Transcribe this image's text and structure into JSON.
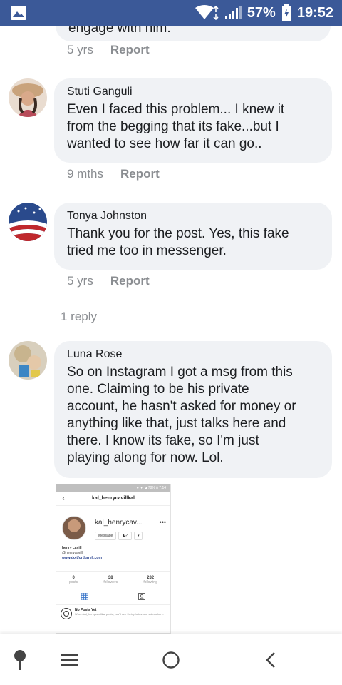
{
  "status_bar": {
    "battery": "57%",
    "time": "19:52"
  },
  "comments": [
    {
      "id": "partial",
      "text": "engage with him.",
      "time": "5 yrs",
      "report_label": "Report"
    },
    {
      "id": "stuti",
      "author": "Stuti Ganguli",
      "lines": [
        "Even I faced this problem... I knew it",
        "from the begging that its fake...but I",
        "wanted to see how far it can go.."
      ],
      "time": "9 mths",
      "report_label": "Report"
    },
    {
      "id": "tonya",
      "author": "Tonya Johnston",
      "lines": [
        "Thank you for the post. Yes, this fake",
        "tried me too in messenger."
      ],
      "time": "5 yrs",
      "report_label": "Report",
      "replies_label": "1 reply"
    },
    {
      "id": "luna",
      "author": "Luna Rose",
      "lines": [
        "So on Instagram I got a msg from this",
        "one. Claiming to be his private",
        "account, he hasn't asked for money or",
        "anything like that, just talks here and",
        "there. I know its fake, so I'm just",
        "playing along for now. Lol."
      ]
    }
  ],
  "attachment": {
    "header_title": "kal_henrycavillkal",
    "username": "kal_henrycav...",
    "more": "•••",
    "message_button": "Message",
    "bio_name": "henry cavill",
    "bio_handle": "@henrycavill",
    "bio_link": "www.doitfordurrell.com",
    "stats": [
      {
        "value": "0",
        "label": "posts"
      },
      {
        "value": "38",
        "label": "followers"
      },
      {
        "value": "232",
        "label": "following"
      }
    ],
    "empty_title": "No Posts Yet",
    "empty_text": "When kal_henrycavillkal posts, you'll see their photos and videos here."
  },
  "colors": {
    "status_bar": "#3b5998",
    "bubble": "#f0f2f5",
    "meta": "#8a8d91"
  }
}
